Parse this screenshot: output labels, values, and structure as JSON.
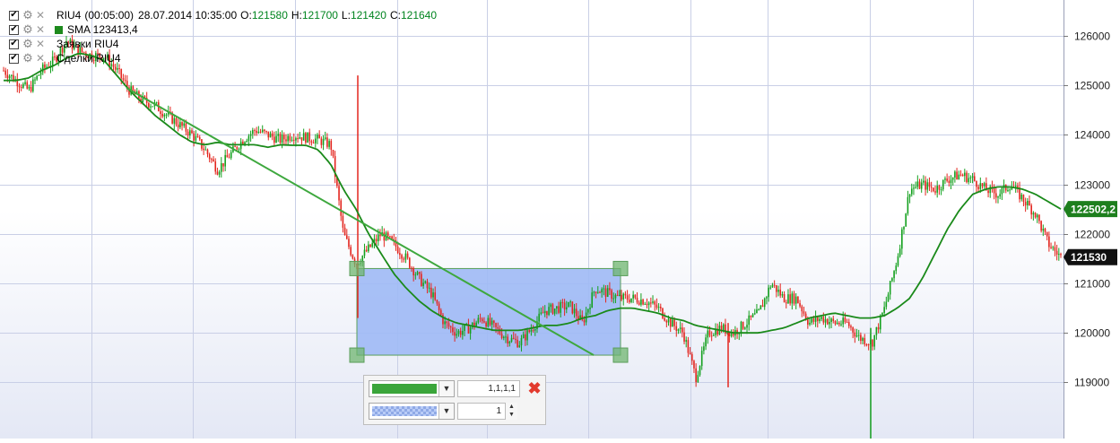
{
  "header": {
    "symbol": "RIU4",
    "timeframe": "(00:05:00)",
    "datetime": "28.07.2014 10:35:00",
    "o_label": "O:",
    "o_value": "121580",
    "h_label": "H:",
    "h_value": "121700",
    "l_label": "L:",
    "l_value": "121420",
    "c_label": "C:",
    "c_value": "121640"
  },
  "legend": [
    {
      "label": "RIU4 (00:05:00) 28.07.2014 10:35:00",
      "color": null
    },
    {
      "label": "SMA  123413,4",
      "color": "#1d8a1d"
    },
    {
      "label": "Заявки RIU4",
      "color": null
    },
    {
      "label": "Сделки RIU4",
      "color": null
    }
  ],
  "colors": {
    "up_candle": "#14a01e",
    "down_candle": "#e3261f",
    "sma_line": "#1a8a1a",
    "trend_line": "#3ea83e",
    "grid": "#c9cfe6",
    "price_box_fill": "#9fb9f5",
    "price_box_stroke": "#5aa05a",
    "sma_tag": "#1d7f1d",
    "last_price_tag": "#111111",
    "ohlc_values": "#00841f"
  },
  "toolbox": {
    "line_width_value": "1,1,1,1",
    "opacity_value": "1",
    "line_color": "#3aa53a",
    "fill_pattern": "checkered-blue",
    "close_icon": "close-icon"
  },
  "chart_data": {
    "type": "candlestick",
    "symbol": "RIU4",
    "ylim": [
      118200,
      126600
    ],
    "y_ticks": [
      "126000",
      "125000",
      "124000",
      "123000",
      "122000",
      "121000",
      "120000",
      "119000"
    ],
    "y_tick_values": [
      126000,
      125000,
      124000,
      123000,
      122000,
      121000,
      120000,
      119000
    ],
    "price_tags": [
      {
        "label": "122502,2",
        "value": 122502.2,
        "series": "SMA"
      },
      {
        "label": "121530",
        "value": 121530,
        "series": "last price"
      }
    ],
    "close_path": [
      125300,
      125100,
      124900,
      125300,
      125500,
      125900,
      125700,
      125600,
      125600,
      125300,
      124900,
      124700,
      124600,
      124400,
      124200,
      124000,
      123700,
      123300,
      123600,
      123900,
      124100,
      124000,
      123900,
      124000,
      123950,
      123900,
      123800,
      122000,
      121400,
      121700,
      122000,
      121800,
      121500,
      121100,
      120800,
      120200,
      120000,
      120100,
      120300,
      120100,
      119900,
      119800,
      120100,
      120450,
      120500,
      120550,
      120200,
      120900,
      120800,
      120700,
      120700,
      120650,
      120500,
      120200,
      120000,
      119100,
      120000,
      120100,
      120000,
      120200,
      120400,
      121000,
      120700,
      120700,
      120200,
      120300,
      120200,
      120200,
      119900,
      119800,
      120500,
      121500,
      122900,
      123000,
      122900,
      123100,
      123200,
      123100,
      122900,
      122800,
      123000,
      122700,
      122400,
      121800,
      121530
    ],
    "sma_path": [
      125100,
      125100,
      125150,
      125300,
      125400,
      125550,
      125650,
      125600,
      125500,
      125200,
      124900,
      124650,
      124400,
      124200,
      124000,
      123850,
      123800,
      123850,
      123800,
      123800,
      123800,
      123750,
      123800,
      123790,
      123790,
      123700,
      123400,
      122900,
      122500,
      122000,
      121600,
      121200,
      120900,
      120650,
      120450,
      120300,
      120200,
      120150,
      120100,
      120050,
      120050,
      120050,
      120100,
      120150,
      120150,
      120200,
      120300,
      120350,
      120450,
      120500,
      120500,
      120450,
      120400,
      120300,
      120250,
      120150,
      120100,
      120050,
      120000,
      120000,
      120000,
      120050,
      120100,
      120200,
      120300,
      120350,
      120400,
      120350,
      120300,
      120300,
      120350,
      120500,
      120700,
      121100,
      121600,
      122100,
      122500,
      122800,
      122900,
      122950,
      122950,
      122900,
      122800,
      122650,
      122502.2
    ],
    "trend_line": {
      "start": 124950,
      "end": 119550
    },
    "price_box": {
      "top": 121300,
      "bottom": 119550
    }
  }
}
